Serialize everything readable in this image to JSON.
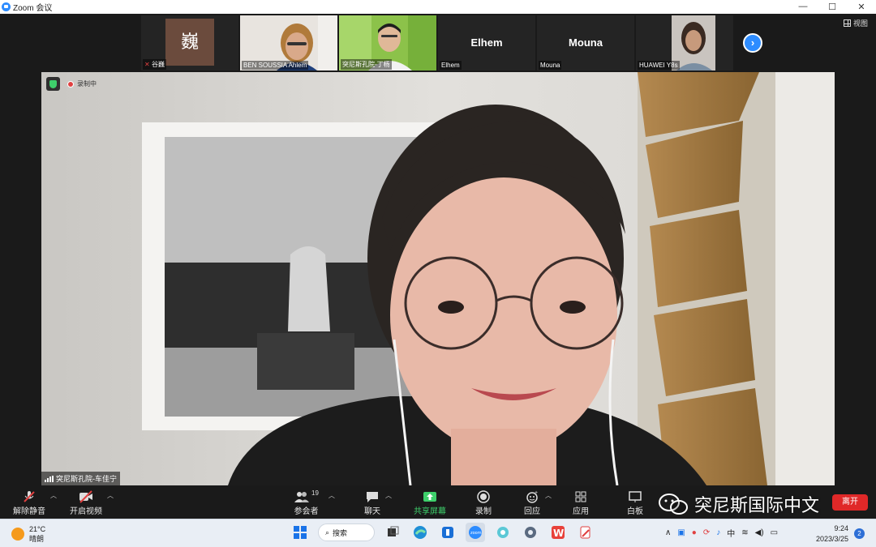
{
  "window": {
    "title": "Zoom 会议",
    "controls": [
      "—",
      "☐",
      "✕"
    ]
  },
  "view_button": "视图",
  "thumbnails": [
    {
      "name": "谷巍",
      "avatar_text": "巍",
      "muted": true
    },
    {
      "name": "BEN SOUSSIA Ahlem"
    },
    {
      "name": "突尼斯孔院-丁杨"
    },
    {
      "name": "Elhem",
      "big_name": "Elhem"
    },
    {
      "name": "Mouna",
      "big_name": "Mouna"
    },
    {
      "name": "HUAWEI Y8s"
    }
  ],
  "main": {
    "recording_label": "录制中",
    "speaker_name": "突尼斯孔院-车佳宁"
  },
  "toolbar": {
    "unmute": "解除静音",
    "start_video": "开启视频",
    "participants": "参会者",
    "participants_count": "19",
    "chat": "聊天",
    "share": "共享屏幕",
    "record": "录制",
    "reactions": "回应",
    "apps": "应用",
    "whiteboard": "白板",
    "leave": "离开"
  },
  "watermark": "突尼斯国际中文",
  "taskbar": {
    "temperature": "21°C",
    "weather": "晴朗",
    "search": "搜索",
    "ime": "中",
    "time": "9:24",
    "date": "2023/3/25",
    "notifications": "2"
  },
  "colors": {
    "zoom_blue": "#2d8cff",
    "leave_red": "#e02828",
    "share_green": "#3ecf6b"
  }
}
